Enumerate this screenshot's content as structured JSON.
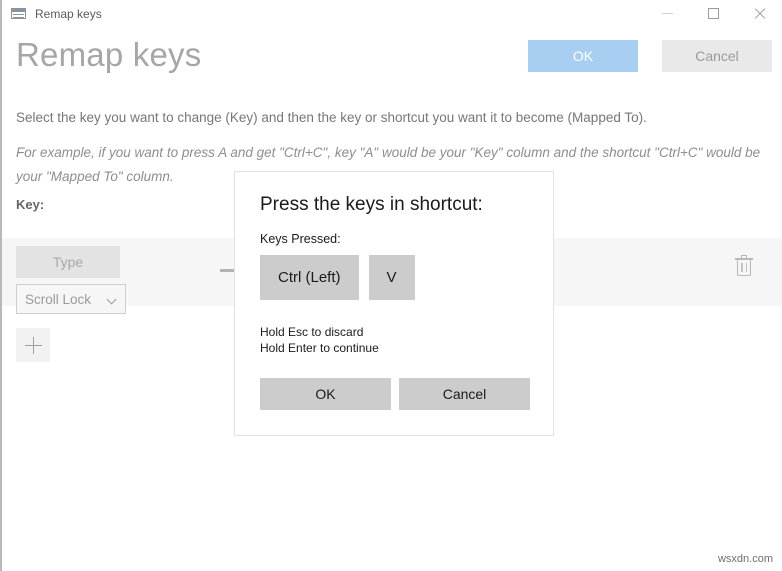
{
  "window": {
    "titlebar": {
      "icon": "keyboard-icon",
      "title": "Remap keys",
      "controls": {
        "minimize": "minimize-icon",
        "maximize": "maximize-icon",
        "close": "close-icon"
      }
    }
  },
  "header": {
    "title": "Remap keys",
    "ok_label": "OK",
    "cancel_label": "Cancel",
    "ok_color": "#a8cff2",
    "cancel_color": "#e9e9e9"
  },
  "description": {
    "line1": "Select the key you want to change (Key) and then the key or shortcut you want it to become (Mapped To).",
    "line2": "For example, if you want to press A and get \"Ctrl+C\", key \"A\" would be your \"Key\" column and the shortcut \"Ctrl+C\" would be your \"Mapped To\" column."
  },
  "table": {
    "column_header_key": "Key:",
    "row": {
      "type_button_label": "Type",
      "key_select_value": "Scroll Lock",
      "delete_icon": "trash-icon"
    },
    "add_button_icon": "plus-icon"
  },
  "dialog": {
    "title": "Press the keys in shortcut:",
    "keys_pressed_label": "Keys Pressed:",
    "keys": [
      {
        "label": "Ctrl (Left)"
      },
      {
        "label": "V"
      }
    ],
    "hint_line1": "Hold Esc to discard",
    "hint_line2": "Hold Enter to continue",
    "ok_label": "OK",
    "cancel_label": "Cancel",
    "key_chip_color": "#cccccc",
    "button_color": "#cccccc"
  },
  "watermark": {
    "text": "wsxdn.com"
  }
}
